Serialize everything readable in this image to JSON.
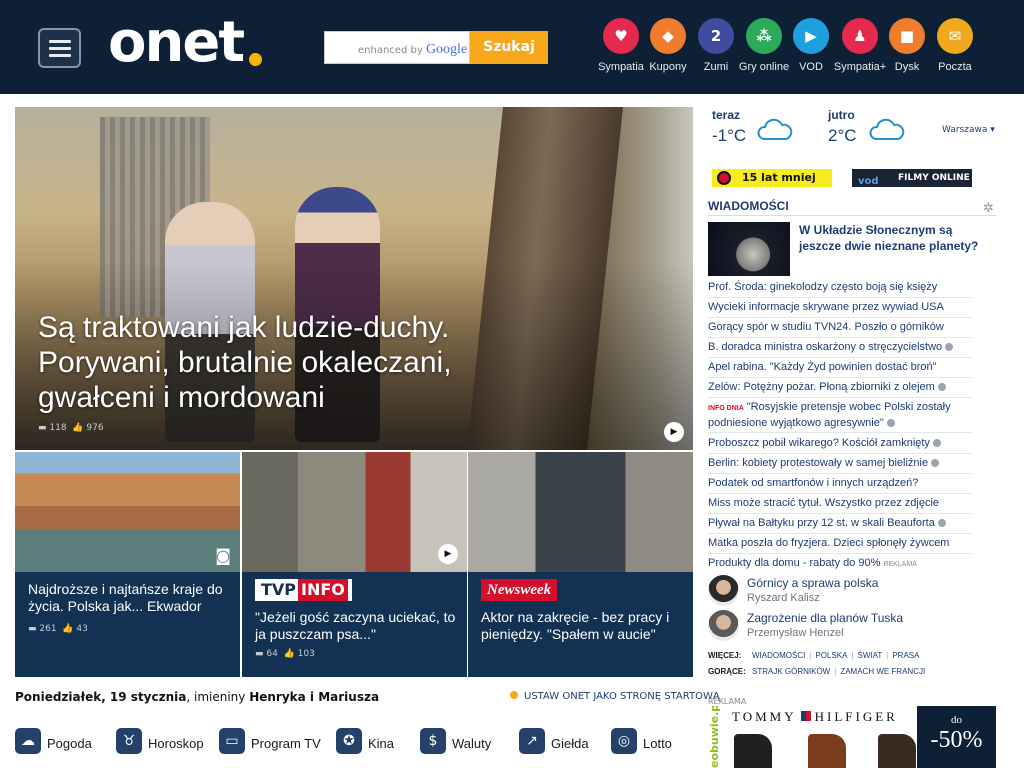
{
  "header": {
    "logo": "onet",
    "search": {
      "label": "enhanced by",
      "brand": "Google",
      "button": "Szukaj"
    },
    "services": [
      {
        "label": "Sympatia",
        "icon": "heart-icon",
        "color": "#e5294f",
        "glyph": "♥"
      },
      {
        "label": "Kupony",
        "icon": "tag-icon",
        "color": "#f07c2d",
        "glyph": "◆"
      },
      {
        "label": "Zumi",
        "icon": "zumi-icon",
        "color": "#3d4c9c",
        "glyph": "2"
      },
      {
        "label": "Gry online",
        "icon": "dice-icon",
        "color": "#2baa5b",
        "glyph": "⁂"
      },
      {
        "label": "VOD",
        "icon": "play-icon",
        "color": "#1f9ee0",
        "glyph": "▶"
      },
      {
        "label": "Sympatia+",
        "icon": "couple-icon",
        "color": "#e5294f",
        "glyph": "♟"
      },
      {
        "label": "Dysk",
        "icon": "disk-icon",
        "color": "#f07c2d",
        "glyph": "■"
      },
      {
        "label": "Poczta",
        "icon": "mail-icon",
        "color": "#f0a81e",
        "glyph": "✉"
      }
    ]
  },
  "hero": {
    "title": "Są traktowani jak ludzie-duchy. Porywani, brutalnie okaleczani, gwałceni i mordowani",
    "comments": "118",
    "likes": "976"
  },
  "tiles": [
    {
      "text": "Najdroższe i najtańsze kraje do życia. Polska jak... Ekwador",
      "comments": "261",
      "likes": "43"
    },
    {
      "badge": "TVP",
      "badge2": "INFO",
      "text": "\"Jeżeli gość zaczyna uciekać, to ja puszczam psa...\"",
      "comments": "64",
      "likes": "103"
    },
    {
      "badge": "Newsweek",
      "text": "Aktor na zakręcie - bez pracy i pieniędzy. \"Spałem w aucie\""
    }
  ],
  "date_line": {
    "day": "Poniedziałek, 19 stycznia",
    "middle": ", imieniny ",
    "names": "Henryka i Mariusza"
  },
  "start_link": "USTAW ONET JAKO STRONĘ STARTOWĄ",
  "bottom_links": [
    {
      "label": "Pogoda",
      "icon": "weather-icon",
      "glyph": "☁"
    },
    {
      "label": "Horoskop",
      "icon": "taurus-icon",
      "glyph": "♉"
    },
    {
      "label": "Program TV",
      "icon": "tv-icon",
      "glyph": "▭"
    },
    {
      "label": "Kina",
      "icon": "film-reel-icon",
      "glyph": "✪"
    },
    {
      "label": "Waluty",
      "icon": "dollar-icon",
      "glyph": "$"
    },
    {
      "label": "Giełda",
      "icon": "chart-icon",
      "glyph": "↗"
    },
    {
      "label": "Lotto",
      "icon": "lotto-icon",
      "glyph": "◎"
    }
  ],
  "weather": {
    "today": {
      "label": "teraz",
      "temp": "-1°C"
    },
    "tomorrow": {
      "label": "jutro",
      "temp": "2°C"
    },
    "city": "Warszawa ▾"
  },
  "promos": {
    "first": "15 lat mniej",
    "second": "FILMY ONLINE »",
    "second_logo": "vod"
  },
  "news": {
    "heading": "WIADOMOŚCI",
    "featured": "W Układzie Słonecznym są jeszcze dwie nieznane planety?",
    "items": [
      {
        "text": "Prof. Środa: ginekolodzy często boją się księży"
      },
      {
        "text": "Wycieki informacje skrywane przez wywiad USA"
      },
      {
        "text": "Gorący spór w studiu TVN24. Poszło o górników"
      },
      {
        "text": "B. doradca ministra oskarżony o stręczycielstwo",
        "icon": true
      },
      {
        "text": "Apel rabina. \"Każdy Żyd powinien dostać broń\""
      },
      {
        "text": "Zelów: Potężny pożar. Płoną zbiorniki z olejem",
        "icon": true
      },
      {
        "tag": "INFO DNIA",
        "text": "\"Rosyjskie pretensje wobec Polski zostały podniesione wyjątkowo agresywnie\"",
        "icon": true
      },
      {
        "text": "Proboszcz pobił wikarego? Kościół zamknięty",
        "icon": true
      },
      {
        "text": "Berlin: kobiety protestowały w samej bieliźnie",
        "icon": true
      },
      {
        "text": "Podatek od smartfonów i innych urządzeń?"
      },
      {
        "text": "Miss może stracić tytuł. Wszystko przez zdjęcie"
      },
      {
        "text": "Pływał na Bałtyku przy 12 st. w skali Beauforta",
        "icon": true
      },
      {
        "text": "Matka poszła do fryzjera. Dzieci spłonęły żywcem"
      },
      {
        "text": "Produkty dla domu - rabaty do 90%",
        "ad": "REKLAMA"
      }
    ],
    "authors": [
      {
        "title": "Górnicy a sprawa polska",
        "name": "Ryszard Kalisz"
      },
      {
        "title": "Zagrożenie dla planów Tuska",
        "name": "Przemysław Henzel"
      }
    ],
    "more": {
      "label": "WIĘCEJ:",
      "links": [
        "WIADOMOŚCI",
        "POLSKA",
        "ŚWIAT",
        "PRASA"
      ]
    },
    "hot": {
      "label": "GORĄCE:",
      "links": [
        "STRAJK GÓRNIKÓW",
        "ZAMACH WE FRANCJI"
      ]
    }
  },
  "ad": {
    "label": "REKLAMA",
    "brand_a": "TOMMY",
    "brand_b": "HILFIGER",
    "side": "eobuwie.pl",
    "promo_a": "do",
    "promo_b": "-50%"
  }
}
